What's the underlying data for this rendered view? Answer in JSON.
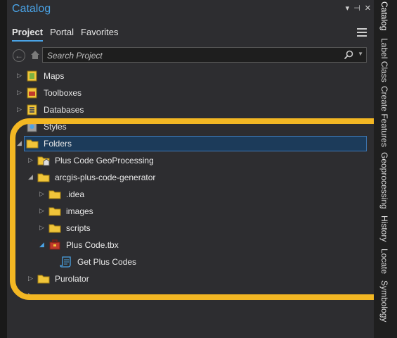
{
  "pane": {
    "title": "Catalog",
    "controls": {
      "dropdown": "▾",
      "pin": "⊣",
      "close": "✕"
    }
  },
  "tabs": [
    {
      "label": "Project",
      "active": true
    },
    {
      "label": "Portal",
      "active": false
    },
    {
      "label": "Favorites",
      "active": false
    }
  ],
  "search": {
    "placeholder": "Search Project",
    "value": ""
  },
  "tree": [
    {
      "label": "Maps",
      "icon": "maps-icon",
      "expander": "collapsed"
    },
    {
      "label": "Toolboxes",
      "icon": "toolbox-icon",
      "expander": "collapsed"
    },
    {
      "label": "Databases",
      "icon": "database-icon",
      "expander": "collapsed"
    },
    {
      "label": "Styles",
      "icon": "styles-icon",
      "expander": "collapsed"
    },
    {
      "label": "Folders",
      "icon": "folder-icon",
      "expander": "expanded",
      "selected": true
    },
    {
      "label": "Plus Code GeoProcessing",
      "icon": "home-folder-icon",
      "expander": "collapsed"
    },
    {
      "label": "arcgis-plus-code-generator",
      "icon": "folder-icon",
      "expander": "expanded"
    },
    {
      "label": ".idea",
      "icon": "folder-icon",
      "expander": "collapsed"
    },
    {
      "label": "images",
      "icon": "folder-icon",
      "expander": "collapsed"
    },
    {
      "label": "scripts",
      "icon": "folder-icon",
      "expander": "collapsed"
    },
    {
      "label": "Plus Code.tbx",
      "icon": "toolbox-icon",
      "expander": "expanded"
    },
    {
      "label": "Get Plus Codes",
      "icon": "script-tool-icon",
      "expander": "none"
    },
    {
      "label": "Purolator",
      "icon": "folder-icon",
      "expander": "collapsed"
    }
  ],
  "right_dock": [
    {
      "label": "Catalog",
      "active": true
    },
    {
      "label": "Label Class",
      "active": false
    },
    {
      "label": "Create Features",
      "active": false
    },
    {
      "label": "Geoprocessing",
      "active": false
    },
    {
      "label": "History",
      "active": false
    },
    {
      "label": "Locate",
      "active": false
    },
    {
      "label": "Symbology",
      "active": false
    }
  ],
  "colors": {
    "accent": "#4aa3e6",
    "highlight_ring": "#f3b723",
    "folder": "#f0c53a",
    "selection": "#1c3b5a"
  }
}
